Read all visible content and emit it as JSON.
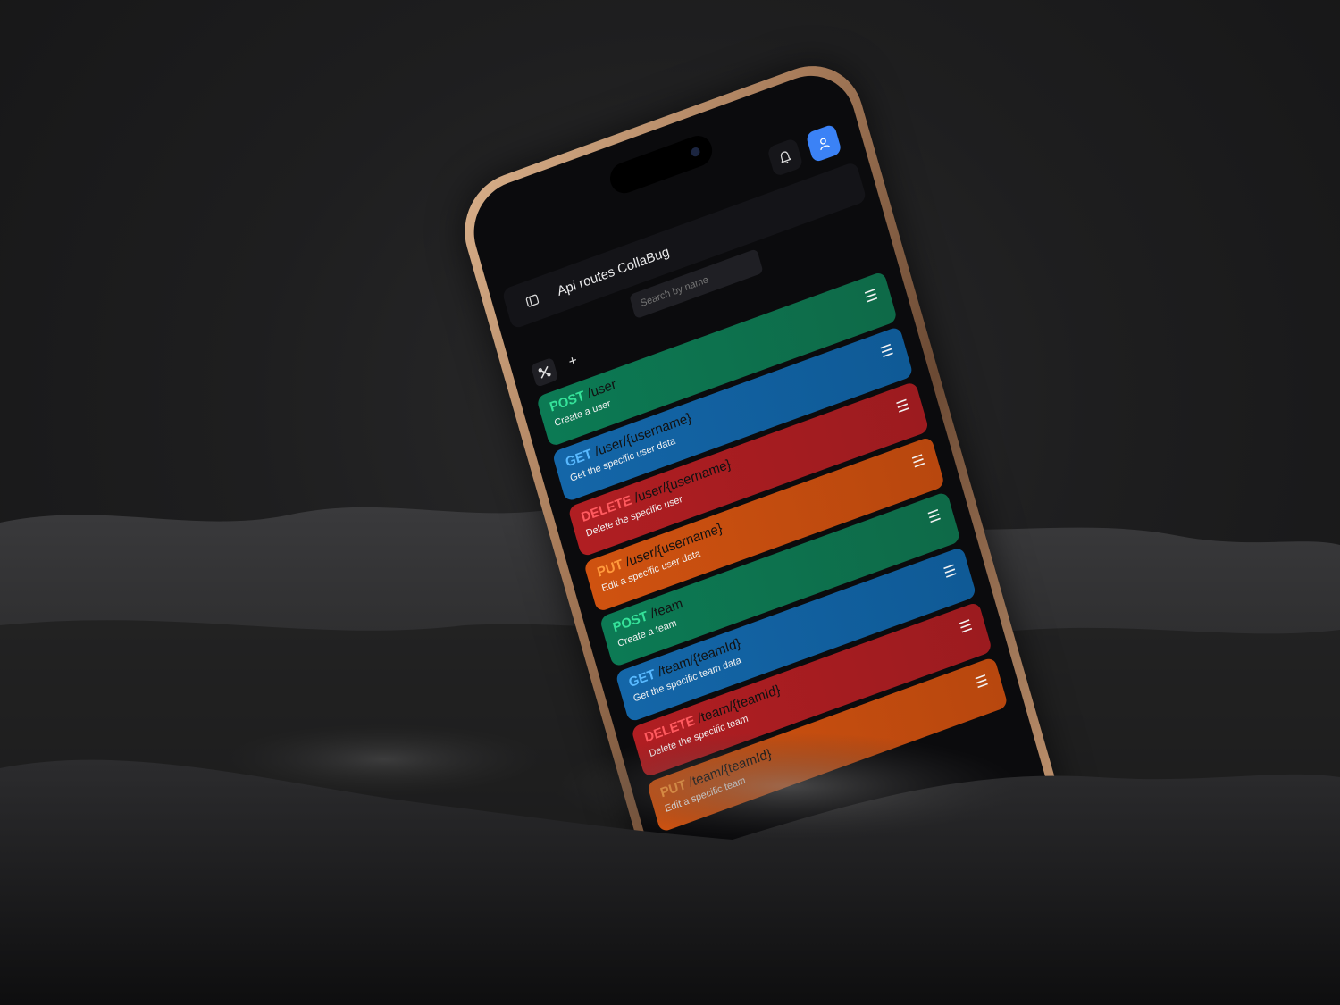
{
  "header": {
    "title": "Api routes  CollaBug"
  },
  "search": {
    "placeholder": "Search by name"
  },
  "toolbar": {
    "add_label": "+"
  },
  "routes": [
    {
      "method": "POST",
      "path": "/user",
      "description": "Create a user",
      "color": "green"
    },
    {
      "method": "GET",
      "path": "/user/{username}",
      "description": "Get the specific user data",
      "color": "blue"
    },
    {
      "method": "DELETE",
      "path": "/user/{username}",
      "description": "Delete the specific user",
      "color": "red"
    },
    {
      "method": "PUT",
      "path": "/user/{username}",
      "description": "Edit a specific user data",
      "color": "orange"
    },
    {
      "method": "POST",
      "path": "/team",
      "description": "Create a team",
      "color": "green"
    },
    {
      "method": "GET",
      "path": "/team/{teamId}",
      "description": "Get the specific team data",
      "color": "blue"
    },
    {
      "method": "DELETE",
      "path": "/team/{teamId}",
      "description": "Delete the specific team",
      "color": "red"
    },
    {
      "method": "PUT",
      "path": "/team/{teamId}",
      "description": "Edit a specific team",
      "color": "orange"
    }
  ],
  "colors": {
    "green": "#0c7a54",
    "blue": "#1466a8",
    "red": "#b01e22",
    "orange": "#cf5210",
    "accent": "#3b82f6"
  },
  "icons": {
    "bell": "bell-icon",
    "user": "user-icon",
    "sidebar": "sidebar-toggle-icon",
    "tools": "tools-icon",
    "menu": "menu-icon"
  }
}
